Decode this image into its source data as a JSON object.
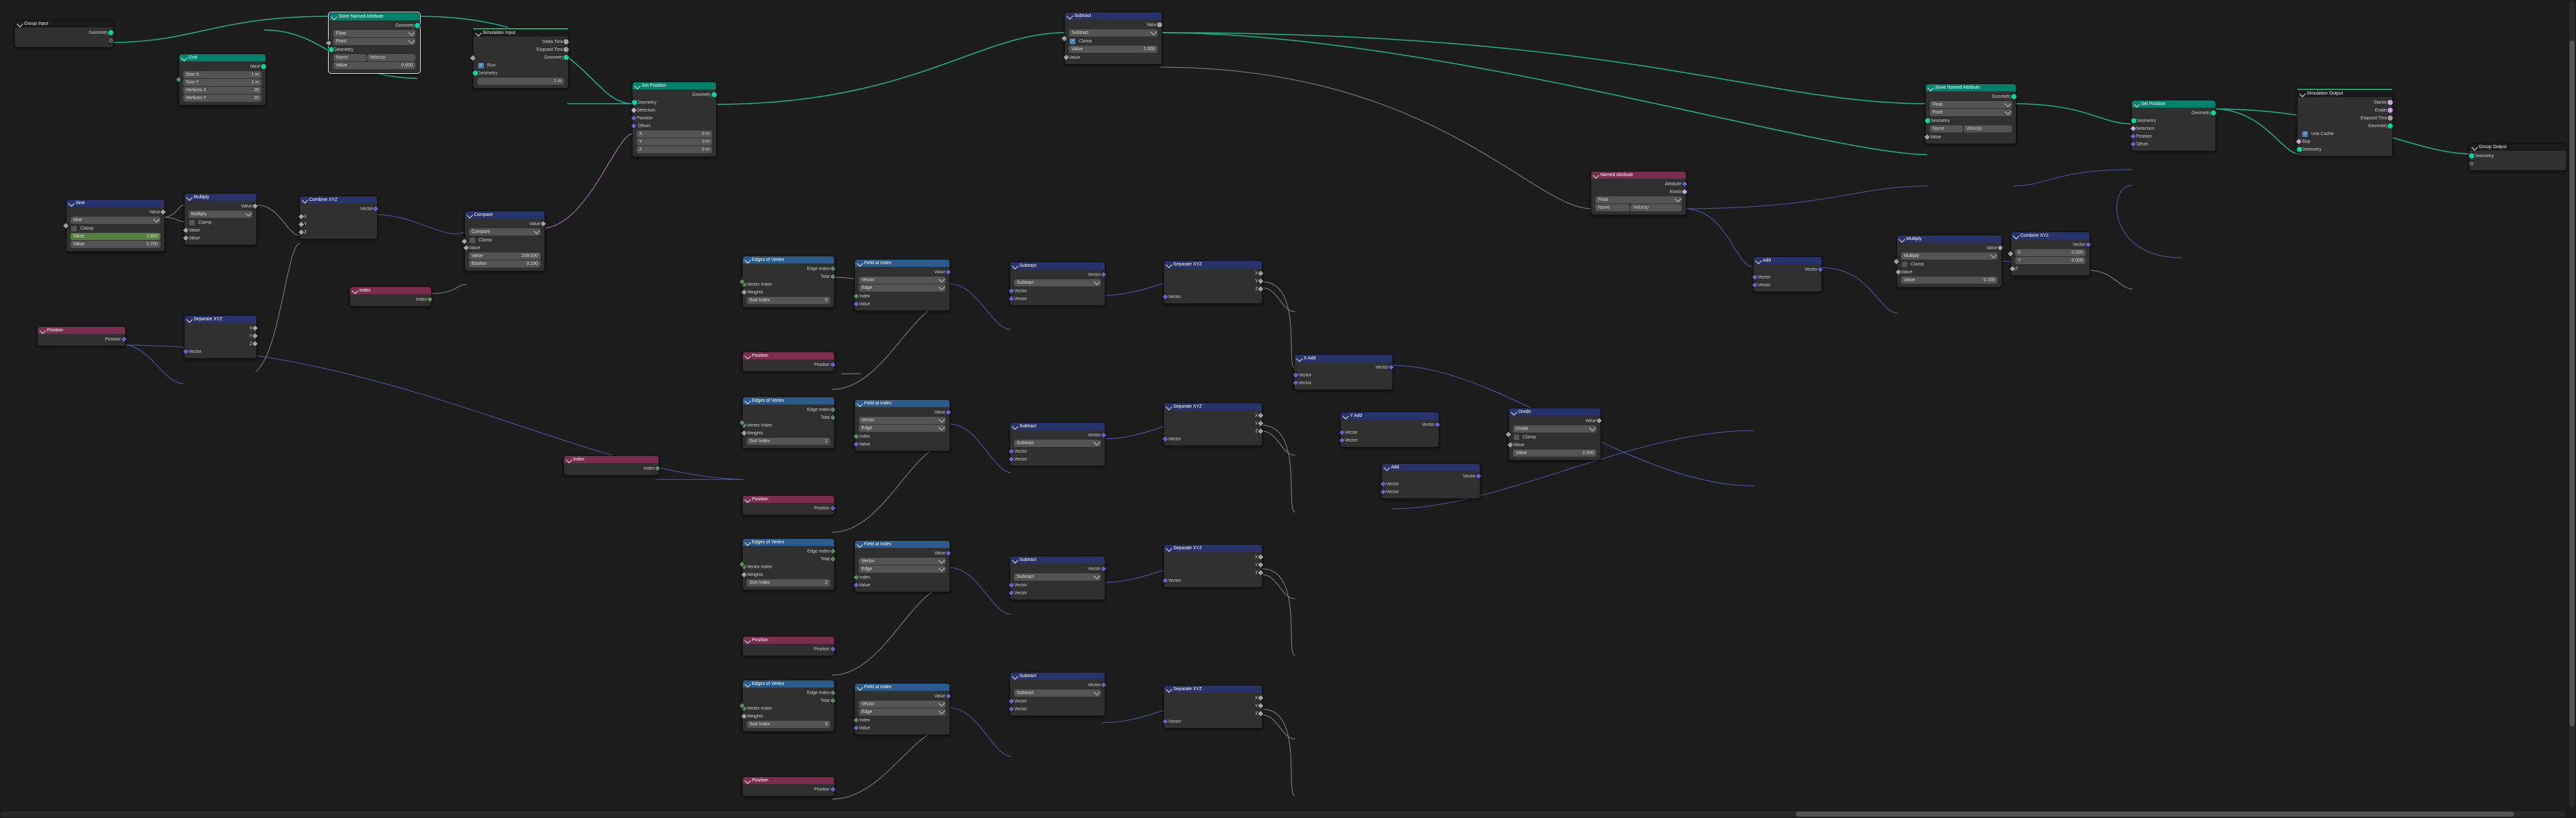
{
  "common": {
    "geometry": "Geometry",
    "value": "Value",
    "vector": "Vector",
    "mesh": "Mesh",
    "selection": "Selection",
    "position": "Position",
    "offset": "Offset",
    "index": "Index",
    "name": "Name",
    "clamp": "Clamp",
    "float": "Float",
    "point": "Point",
    "attribute": "Attribute",
    "exists": "Exists",
    "total": "Total",
    "edge": "Edge",
    "X": "X",
    "Y": "Y",
    "Z": "Z",
    "edge_index": "Edge Index",
    "vertex_index": "Vertex Index",
    "weights": "Weights",
    "sort_index": "Sort Index"
  },
  "group_input": {
    "title": "Group Input"
  },
  "group_output": {
    "title": "Group Output",
    "geometry": "Geometry"
  },
  "grid": {
    "title": "Grid",
    "size_x": "Size X",
    "size_x_v": "1 m",
    "size_y": "Size Y",
    "size_y_v": "1 m",
    "vx": "Vertices X",
    "vx_v": "20",
    "vy": "Vertices Y",
    "vy_v": "20"
  },
  "store1": {
    "title": "Store Named Attribute",
    "velocity": "Velocity",
    "valv": "0.000"
  },
  "store2": {
    "title": "Store Named Attribute",
    "velocity": "Velocity"
  },
  "sim_in": {
    "title": "Simulation Input",
    "delta": "Delta Time",
    "elapsed": "Elapsed Time",
    "run": "Run",
    "one": "1 m"
  },
  "sim_out": {
    "title": "Simulation Output",
    "started": "Started",
    "ended": "Ended",
    "elapsed": "Elapsed Time",
    "skip": "Skip",
    "use_cache": "Use Cache"
  },
  "set_pos": {
    "title": "Set Position",
    "zero": "0 m"
  },
  "sub": {
    "title": "Subtract",
    "sub": "Subtract",
    "v1": "1.000"
  },
  "named_attr": {
    "title": "Named Attribute",
    "velocity": "Velocity"
  },
  "multiply": {
    "title": "Multiply",
    "mul": "Multiply",
    "v": "0.100"
  },
  "add": {
    "title": "Add"
  },
  "divide": {
    "title": "Divide",
    "div": "Divide",
    "v": "2.000"
  },
  "combine": {
    "title": "Combine XYZ",
    "v": "0.000"
  },
  "sepxyz": {
    "title": "Separate XYZ"
  },
  "compare": {
    "title": "Compare",
    "compare": "Compare",
    "v1": "209.000",
    "eps": "Epsilon",
    "epsv": "0.100"
  },
  "pos": {
    "title": "Position"
  },
  "idx": {
    "title": "Index"
  },
  "sine": {
    "title": "Sine",
    "sine": "Sine",
    "v0": "0.200",
    "v1": "2.800"
  },
  "mul2": {
    "title": "Multiply"
  },
  "eov": {
    "title": "Edges of Vertex"
  },
  "fai": {
    "title": "Field at Index"
  },
  "si": [
    "0",
    "1",
    "2",
    "3"
  ]
}
